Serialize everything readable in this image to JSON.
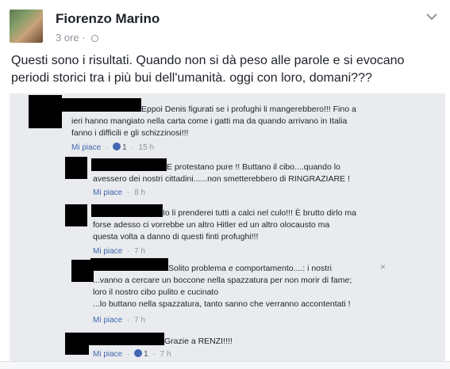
{
  "post": {
    "author": "Fiorenzo Marino",
    "time": "3 ore",
    "separator": "·",
    "text_lines": [
      "Questi sono i risultati. Quando non si dà peso alle parole e si evocano",
      "periodi storici tra i più bui dell'umanità.  oggi con loro, domani???"
    ]
  },
  "screenshot": {
    "comments": [
      {
        "lines": [
          "Eppoi Denis figurati se i profughi li mangerebbero!!! Fino a",
          "ieri hanno mangiato nella carta come i gatti ma da quando arrivano in Italia",
          "fanno i difficili e gli schizzinosi!!!"
        ],
        "like": "Mi piace",
        "likes": "1",
        "time": "15 h"
      },
      {
        "lines": [
          "E protestano pure !! Buttano il cibo....quando lo",
          "avessero dei nostri cittadini......non smetterebbero di RINGRAZIARE !"
        ],
        "like": "Mi piace",
        "time": "8 h"
      },
      {
        "lines": [
          "Io li prenderei tutti a calci nel culo!!! È brutto dirlo ma",
          "forse adesso ci vorrebbe un altro Hitler ed un altro olocausto ma",
          "questa volta a danno di questi finti profughi!!!"
        ],
        "like": "Mi piace",
        "time": "7 h"
      },
      {
        "lines": [
          "Solito problema e comportamento....: i nostri",
          "...vanno a cercare un boccone nella spazzatura per non morir di fame;",
          "loro il nostro cibo pulito e cucinato",
          "...lo buttano nella spazzatura, tanto sanno che verranno accontentati !"
        ],
        "like": "Mi piace",
        "time": "7 h",
        "close": "×"
      },
      {
        "lines": [
          "Grazie a RENZI!!!!"
        ],
        "like": "Mi piace",
        "likes": "1",
        "time": "7 h"
      }
    ]
  }
}
